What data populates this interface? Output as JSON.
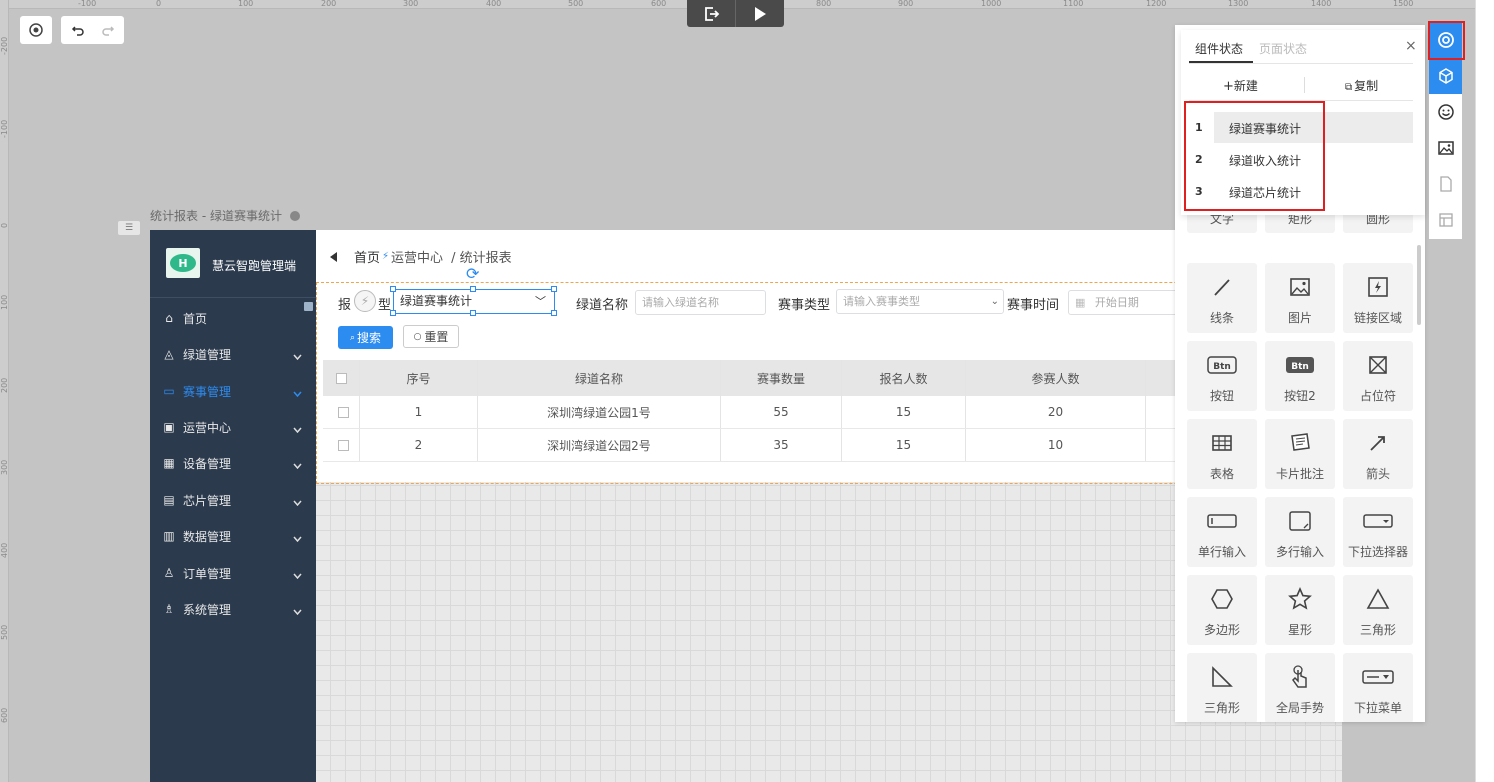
{
  "rulers": {
    "top": [
      "-100",
      "0",
      "100",
      "200",
      "300",
      "400",
      "500",
      "600",
      "700",
      "800",
      "900",
      "1000",
      "1100",
      "1200",
      "1300",
      "1400",
      "1500"
    ],
    "left": [
      "-200",
      "-100",
      "0",
      "100",
      "200",
      "300",
      "400",
      "500",
      "600"
    ]
  },
  "page": {
    "label": "统计报表 - 绿道赛事统计"
  },
  "app": {
    "logo_title": "慧云智跑管理端",
    "nav": [
      {
        "label": "首页",
        "icon": "home-icon"
      },
      {
        "label": "绿道管理",
        "icon": "layers-icon"
      },
      {
        "label": "赛事管理",
        "icon": "card-icon",
        "active": true
      },
      {
        "label": "运营中心",
        "icon": "calendar-icon"
      },
      {
        "label": "设备管理",
        "icon": "device-icon"
      },
      {
        "label": "芯片管理",
        "icon": "chip-icon"
      },
      {
        "label": "数据管理",
        "icon": "database-icon"
      },
      {
        "label": "订单管理",
        "icon": "user-icon"
      },
      {
        "label": "系统管理",
        "icon": "people-icon"
      }
    ],
    "breadcrumb": [
      "首页",
      "运营中心",
      "/ 统计报表"
    ],
    "form": {
      "report_type_label_a": "报",
      "report_type_label_b": "型",
      "report_type_value": "绿道赛事统计",
      "greenway_label": "绿道名称",
      "greenway_placeholder": "请输入绿道名称",
      "event_type_label": "赛事类型",
      "event_type_placeholder": "请输入赛事类型",
      "event_time_label": "赛事时间",
      "start_date_placeholder": "开始日期",
      "search_btn": "搜索",
      "reset_btn": "重置"
    },
    "table": {
      "columns": [
        "序号",
        "绿道名称",
        "赛事数量",
        "报名人数",
        "参赛人数"
      ],
      "rows": [
        [
          "1",
          "深圳湾绿道公园1号",
          "55",
          "15",
          "20"
        ],
        [
          "2",
          "深圳湾绿道公园2号",
          "35",
          "15",
          "10"
        ]
      ]
    }
  },
  "state_popup": {
    "tab_component": "组件状态",
    "tab_page": "页面状态",
    "new_label": "新建",
    "copy_label": "复制",
    "states": [
      {
        "num": "1",
        "name": "绿道赛事统计",
        "selected": true
      },
      {
        "num": "2",
        "name": "绿道收入统计"
      },
      {
        "num": "3",
        "name": "绿道芯片统计"
      }
    ]
  },
  "library": {
    "items": [
      {
        "label": "文字",
        "icon": "text-icon"
      },
      {
        "label": "矩形",
        "icon": "rectangle-icon"
      },
      {
        "label": "圆形",
        "icon": "circle-icon"
      },
      {
        "label": "线条",
        "icon": "line-icon"
      },
      {
        "label": "图片",
        "icon": "image-icon"
      },
      {
        "label": "链接区域",
        "icon": "hotspot-icon"
      },
      {
        "label": "按钮",
        "icon": "button-icon",
        "glyph": "Btn"
      },
      {
        "label": "按钮2",
        "icon": "button2-icon",
        "glyph": "Btn"
      },
      {
        "label": "占位符",
        "icon": "placeholder-icon"
      },
      {
        "label": "表格",
        "icon": "table-icon"
      },
      {
        "label": "卡片批注",
        "icon": "note-icon"
      },
      {
        "label": "箭头",
        "icon": "arrow-icon"
      },
      {
        "label": "单行输入",
        "icon": "single-input-icon"
      },
      {
        "label": "多行输入",
        "icon": "textarea-icon"
      },
      {
        "label": "下拉选择器",
        "icon": "select-icon"
      },
      {
        "label": "多边形",
        "icon": "polygon-icon"
      },
      {
        "label": "星形",
        "icon": "star-icon"
      },
      {
        "label": "三角形",
        "icon": "triangle-icon"
      },
      {
        "label": "三角形",
        "icon": "right-triangle-icon"
      },
      {
        "label": "全局手势",
        "icon": "gesture-icon"
      },
      {
        "label": "下拉菜单",
        "icon": "dropdown-menu-icon"
      }
    ]
  }
}
